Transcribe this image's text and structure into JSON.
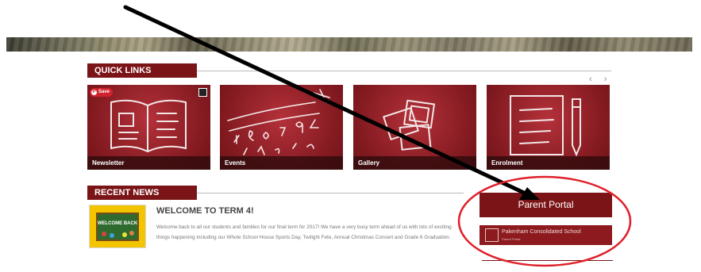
{
  "quick_links": {
    "title": "QUICK LINKS",
    "arrows": "‹ ›",
    "tiles": [
      {
        "label": "Newsletter",
        "icon": "book-icon"
      },
      {
        "label": "Events",
        "icon": "chalk-numbers-icon"
      },
      {
        "label": "Gallery",
        "icon": "photos-icon"
      },
      {
        "label": "Enrolment",
        "icon": "form-pencil-icon"
      }
    ],
    "save_label": "Save"
  },
  "recent_news": {
    "title": "RECENT NEWS",
    "item": {
      "title": "WELCOME TO TERM 4!",
      "thumb_text": "WELCOME BACK",
      "body": "Welcome back to all our students and families for our final term for 2017! We have a very busy term ahead of us with lots of exciting things happening including our Whole School House Sports Day, Twilight Fete, Annual Christmas Concert and Grade 6 Graduation."
    }
  },
  "sidebar": {
    "portal_label": "Parent Portal",
    "school_name": "Pakenham Consolidated School",
    "school_sub": "Parent Portal"
  },
  "colors": {
    "brand": "#7b1416",
    "annotation_red": "#e0202a",
    "arrow": "#000000"
  }
}
